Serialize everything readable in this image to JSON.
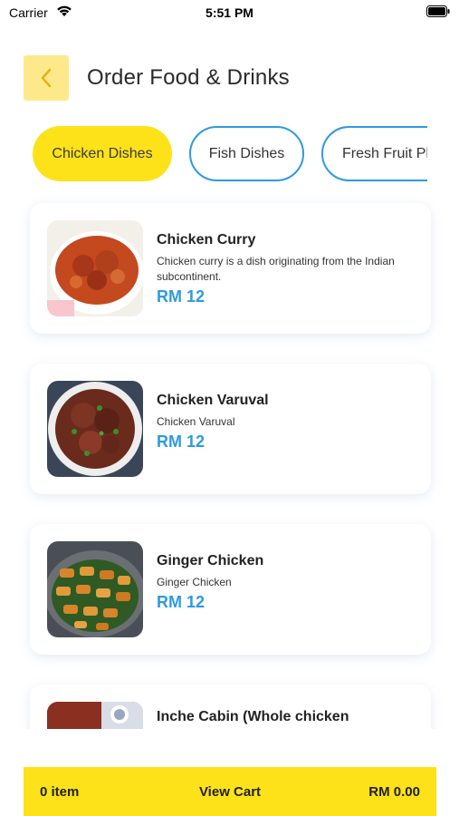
{
  "status_bar": {
    "carrier": "Carrier",
    "time": "5:51 PM"
  },
  "header": {
    "title": "Order Food & Drinks",
    "back_icon": "chevron-left-icon"
  },
  "tabs": [
    {
      "label": "Chicken Dishes",
      "active": true
    },
    {
      "label": "Fish Dishes",
      "active": false
    },
    {
      "label": "Fresh Fruit Pl",
      "active": false
    }
  ],
  "items": [
    {
      "name": "Chicken Curry",
      "description": "Chicken curry is a dish originating from the Indian subcontinent.",
      "price": "RM 12"
    },
    {
      "name": "Chicken Varuval",
      "description": "Chicken Varuval",
      "price": "RM 12"
    },
    {
      "name": "Ginger Chicken",
      "description": "Ginger Chicken",
      "price": "RM 12"
    },
    {
      "name": "Inche Cabin (Whole chicken",
      "description": "",
      "price": ""
    }
  ],
  "cart": {
    "count": "0 item",
    "view_label": "View Cart",
    "total": "RM 0.00"
  },
  "colors": {
    "accent_yellow": "#fde21a",
    "accent_blue": "#2d9ae0",
    "back_button_bg": "#fde98a"
  }
}
